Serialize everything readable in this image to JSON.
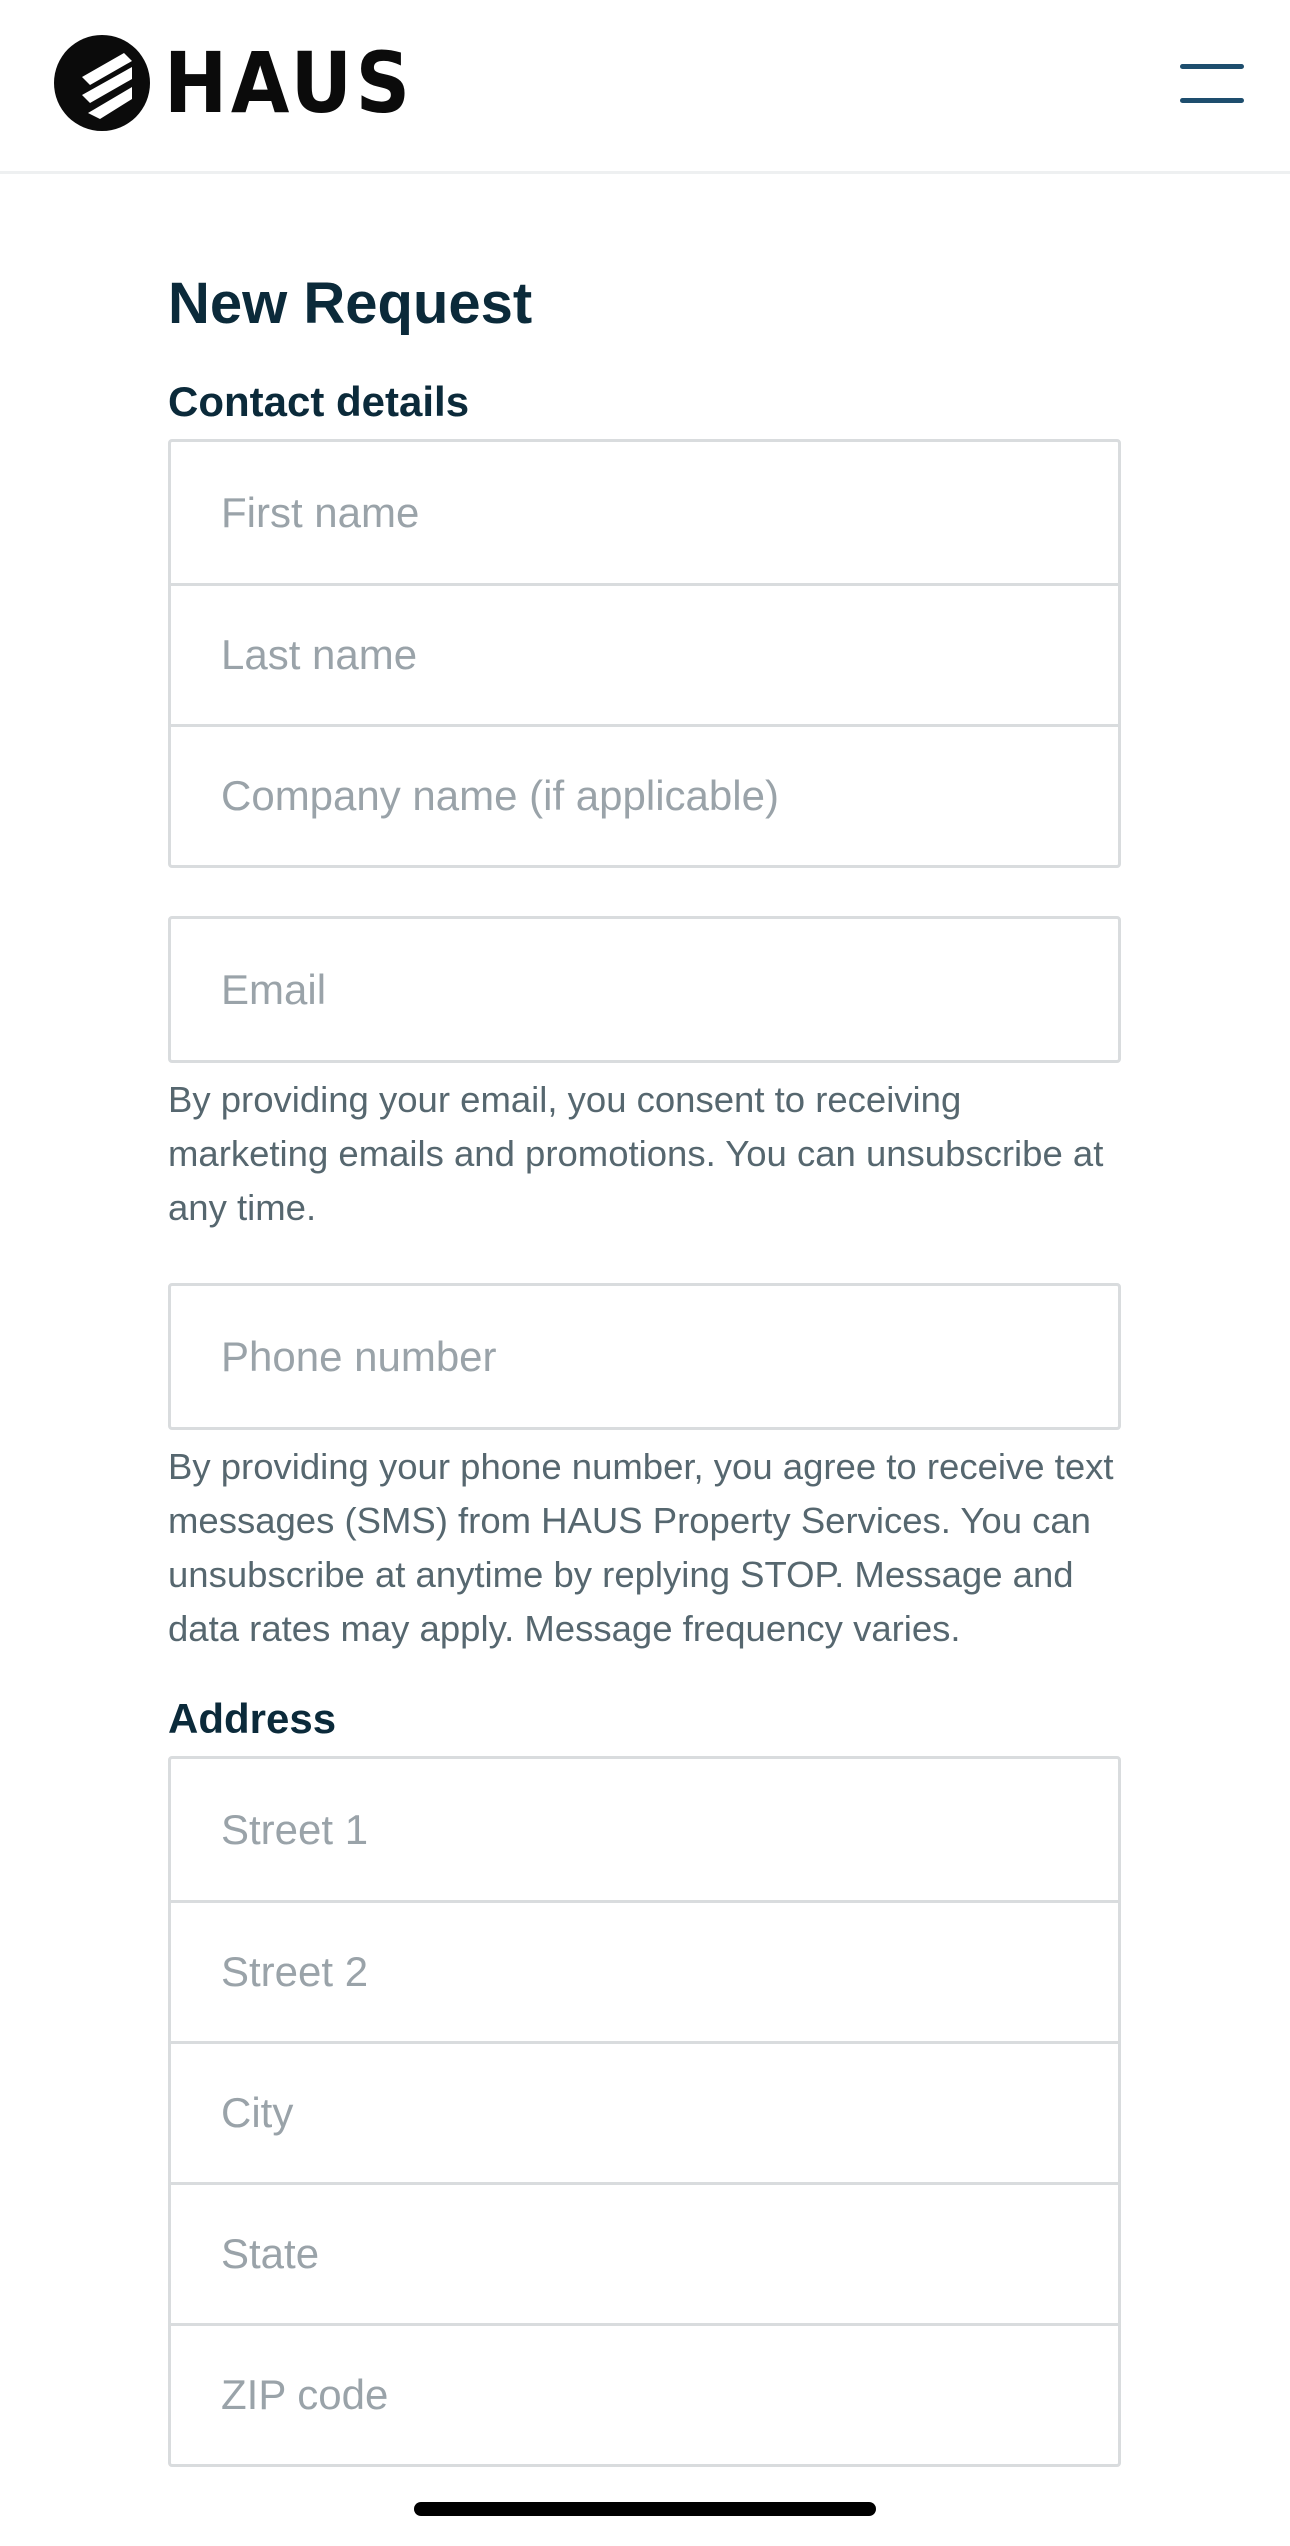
{
  "header": {
    "logo_text": "HAUS",
    "menu_icon": "hamburger-menu-icon"
  },
  "main": {
    "title": "New Request",
    "contact": {
      "label": "Contact details",
      "first_name_placeholder": "First name",
      "last_name_placeholder": "Last name",
      "company_placeholder": "Company name (if applicable)"
    },
    "email": {
      "placeholder": "Email",
      "help": "By providing your email, you consent to receiving marketing emails and promotions. You can unsubscribe at any time."
    },
    "phone": {
      "placeholder": "Phone number",
      "help": "By providing your phone number, you agree to receive text messages (SMS) from HAUS Property Services. You can unsubscribe at anytime by replying STOP. Message and data rates may apply. Message frequency varies."
    },
    "address": {
      "label": "Address",
      "street1_placeholder": "Street 1",
      "street2_placeholder": "Street 2",
      "city_placeholder": "City",
      "state_placeholder": "State",
      "zip_placeholder": "ZIP code"
    }
  }
}
